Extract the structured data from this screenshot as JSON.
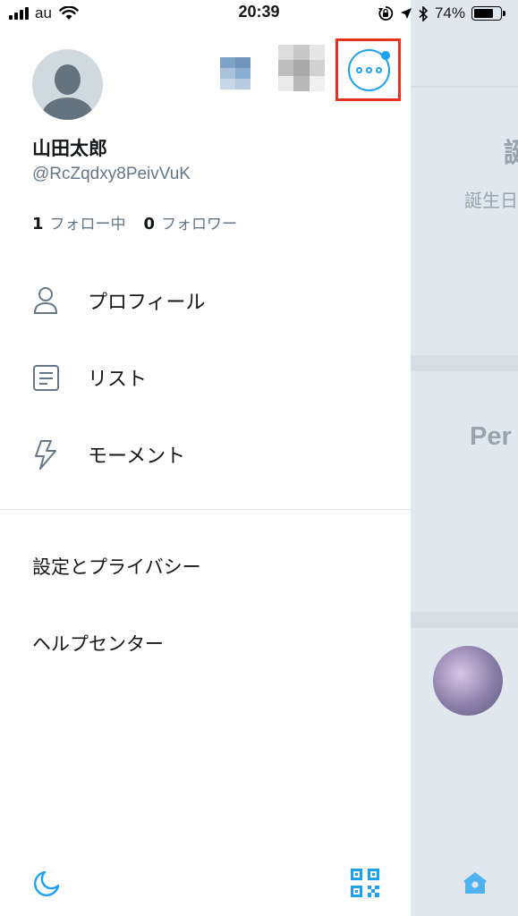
{
  "status_bar": {
    "carrier": "au",
    "time": "20:39",
    "battery": "74%",
    "battery_level": 0.74
  },
  "drawer": {
    "profile": {
      "name": "山田太郎",
      "handle": "@RcZqdxy8PeivVuK"
    },
    "stats": {
      "following_count": "1",
      "following_label": "フォロー中",
      "followers_count": "0",
      "followers_label": "フォロワー"
    },
    "menu": [
      {
        "label": "プロフィール",
        "icon": "person-icon"
      },
      {
        "label": "リスト",
        "icon": "list-icon"
      },
      {
        "label": "モーメント",
        "icon": "lightning-icon"
      }
    ],
    "secondary_menu": [
      {
        "label": "設定とプライバシー"
      },
      {
        "label": "ヘルプセンター"
      }
    ],
    "footer": {
      "left_icon": "night-mode-icon",
      "right_icon": "qr-code-icon"
    }
  },
  "background": {
    "text_1": "誕",
    "text_2": "誕生日",
    "text_3": "Per"
  },
  "colors": {
    "accent": "#1da1f2",
    "highlight": "#e5321f",
    "secondary_text": "#657786"
  }
}
